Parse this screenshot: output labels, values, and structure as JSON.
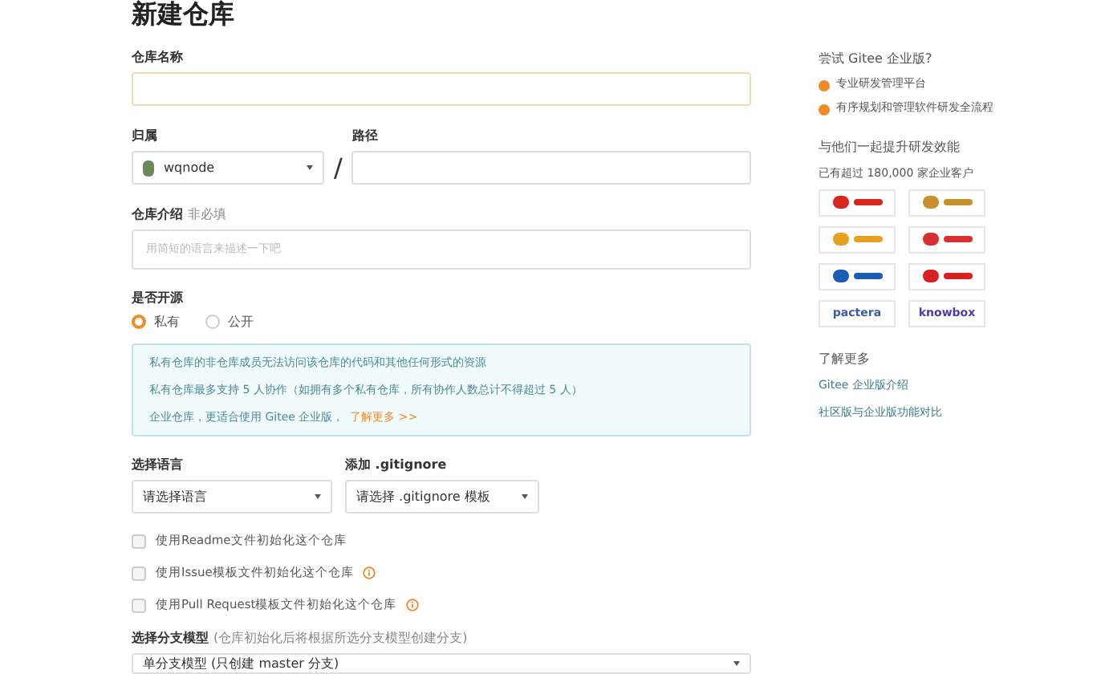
{
  "title": "新建仓库",
  "name_field": {
    "label": "仓库名称"
  },
  "owner": {
    "label": "归属",
    "value": "wqnode",
    "separator": "/"
  },
  "path": {
    "label": "路径"
  },
  "description": {
    "label": "仓库介绍",
    "hint": "非必填",
    "placeholder": "用简短的语言来描述一下吧"
  },
  "visibility": {
    "label": "是否开源",
    "options": [
      {
        "label": "私有",
        "selected": true
      },
      {
        "label": "公开",
        "selected": false
      }
    ]
  },
  "notice": {
    "lines": [
      "私有仓库的非仓库成员无法访问该仓库的代码和其他任何形式的资源",
      "私有仓库最多支持 5 人协作（如拥有多个私有仓库，所有协作人数总计不得超过 5 人）",
      "企业仓库，更适合使用 Gitee 企业版，"
    ],
    "link": "了解更多 >>"
  },
  "language": {
    "label": "选择语言",
    "value": "请选择语言"
  },
  "gitignore": {
    "label": "添加 .gitignore",
    "value": "请选择 .gitignore 模板"
  },
  "options": [
    {
      "label": "使用Readme文件初始化这个仓库",
      "checked": false,
      "info": false
    },
    {
      "label": "使用Issue模板文件初始化这个仓库",
      "checked": false,
      "info": true
    },
    {
      "label": "使用Pull Request模板文件初始化这个仓库",
      "checked": false,
      "info": true
    }
  ],
  "branch_model": {
    "label": "选择分支模型",
    "hint": "(仓库初始化后将根据所选分支模型创建分支)",
    "value": "单分支模型 (只创建 master 分支)"
  },
  "sidebar": {
    "promo_title": "尝试 Gitee 企业版?",
    "features": [
      "专业研发管理平台",
      "有序规划和管理软件研发全流程"
    ],
    "customers_title": "与他们一起提升研发效能",
    "customers_count": "已有超过 180,000 家企业客户",
    "logos": [
      {
        "color": "#d7261e"
      },
      {
        "color": "#c8902a"
      },
      {
        "color": "#e8a020"
      },
      {
        "color": "#d83030"
      },
      {
        "color": "#1a5db0"
      },
      {
        "color": "#d82020"
      },
      {
        "color": "#3a5ba8",
        "text": "pactera"
      },
      {
        "color": "#4a3ab0",
        "text": "knowbox"
      }
    ],
    "more_title": "了解更多",
    "links": [
      "Gitee 企业版介绍",
      "社区版与企业版功能对比"
    ]
  }
}
